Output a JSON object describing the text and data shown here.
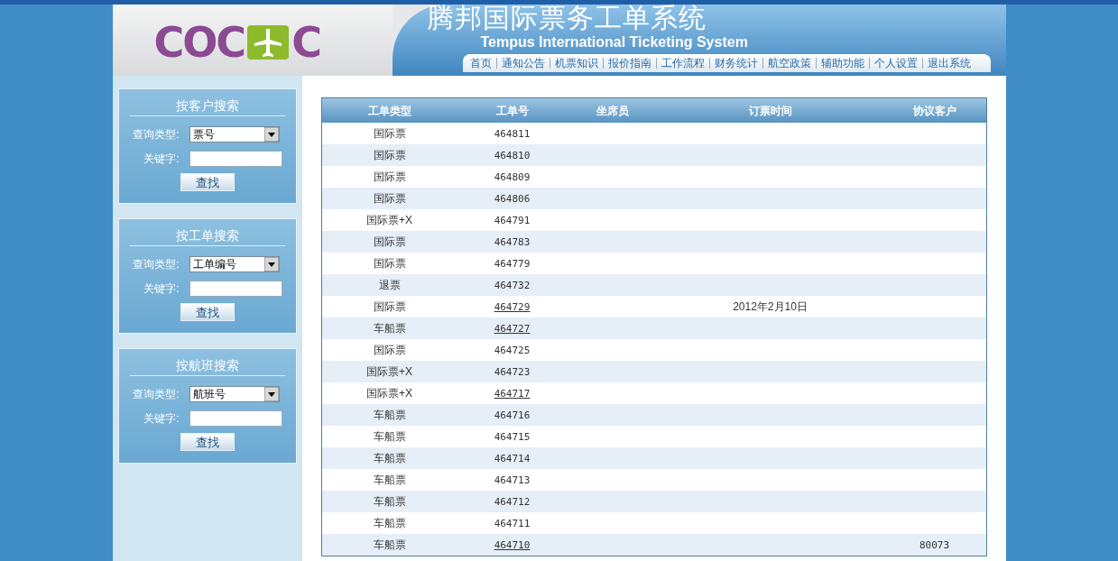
{
  "header": {
    "logo_left": "COC",
    "logo_right": "C",
    "title": "腾邦国际票务工单系统",
    "subtitle": "Tempus International Ticketing System",
    "nav": [
      "首页",
      "通知公告",
      "机票知识",
      "报价指南",
      "工作流程",
      "财务统计",
      "航空政策",
      "辅助功能",
      "个人设置",
      "退出系统"
    ]
  },
  "search_panels": [
    {
      "title": "按客户搜索",
      "type_label": "查询类型:",
      "type_value": "票号",
      "keyword_label": "关键字:",
      "button": "查找"
    },
    {
      "title": "按工单搜索",
      "type_label": "查询类型:",
      "type_value": "工单编号",
      "keyword_label": "关键字:",
      "button": "查找"
    },
    {
      "title": "按航班搜索",
      "type_label": "查询类型:",
      "type_value": "航班号",
      "keyword_label": "关键字:",
      "button": "查找"
    }
  ],
  "table": {
    "columns": [
      "工单类型",
      "工单号",
      "坐席员",
      "订票时间",
      "协议客户"
    ],
    "rows": [
      {
        "type": "国际票",
        "number": "464811",
        "linked": false
      },
      {
        "type": "国际票",
        "number": "464810",
        "linked": false
      },
      {
        "type": "国际票",
        "number": "464809",
        "linked": false
      },
      {
        "type": "国际票",
        "number": "464806",
        "linked": false
      },
      {
        "type": "国际票+X",
        "number": "464791",
        "linked": false
      },
      {
        "type": "国际票",
        "number": "464783",
        "linked": false
      },
      {
        "type": "国际票",
        "number": "464779",
        "linked": false
      },
      {
        "type": "退票",
        "number": "464732",
        "linked": false
      },
      {
        "type": "国际票",
        "number": "464729",
        "linked": true,
        "booked_at": "2012年2月10日"
      },
      {
        "type": "车船票",
        "number": "464727",
        "linked": true
      },
      {
        "type": "国际票",
        "number": "464725",
        "linked": false
      },
      {
        "type": "国际票+X",
        "number": "464723",
        "linked": false
      },
      {
        "type": "国际票+X",
        "number": "464717",
        "linked": true
      },
      {
        "type": "车船票",
        "number": "464716",
        "linked": false
      },
      {
        "type": "车船票",
        "number": "464715",
        "linked": false
      },
      {
        "type": "车船票",
        "number": "464714",
        "linked": false
      },
      {
        "type": "车船票",
        "number": "464713",
        "linked": false
      },
      {
        "type": "车船票",
        "number": "464712",
        "linked": false
      },
      {
        "type": "车船票",
        "number": "464711",
        "linked": false
      },
      {
        "type": "车船票",
        "number": "464710",
        "linked": true,
        "client": "80073"
      }
    ]
  }
}
